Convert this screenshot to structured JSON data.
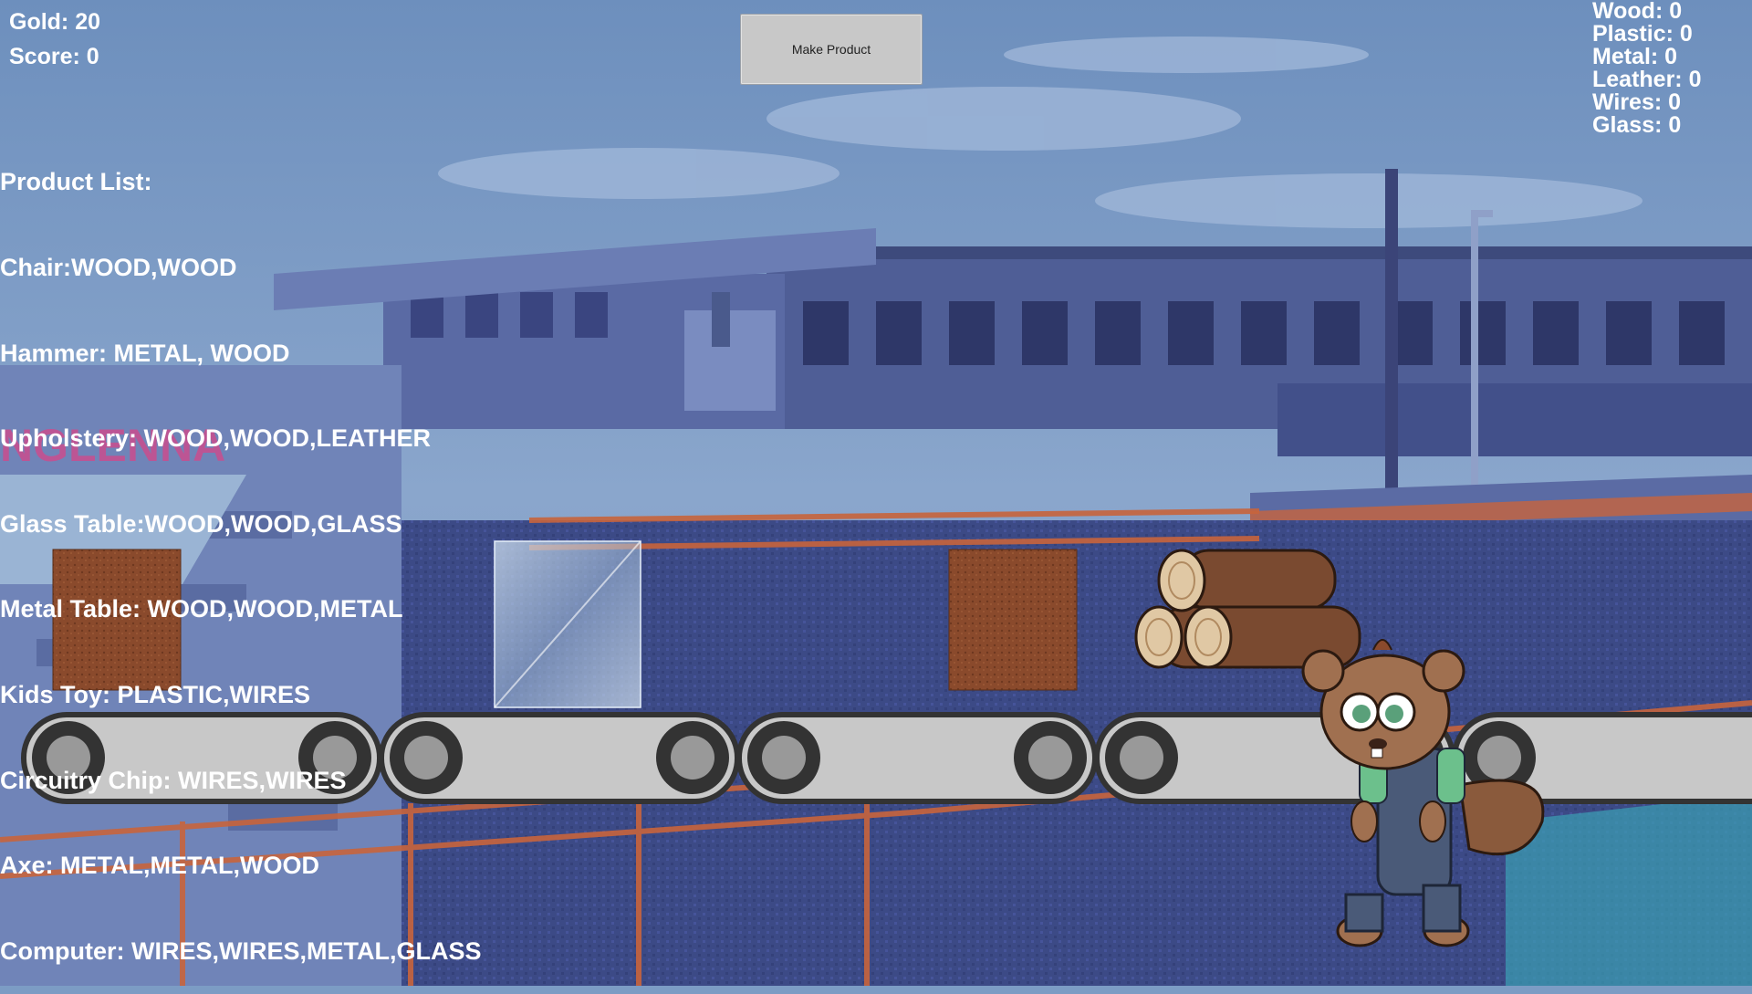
{
  "hud": {
    "gold": "Gold: 20",
    "score": "Score: 0",
    "make_product_label": "Make Product"
  },
  "product_list": {
    "title": "Product List:",
    "items": [
      "Chair:WOOD,WOOD",
      "Hammer: METAL, WOOD",
      "Upholstery: WOOD,WOOD,LEATHER",
      "Glass Table:WOOD,WOOD,GLASS",
      "Metal Table: WOOD,WOOD,METAL",
      "Kids Toy: PLASTIC,WIRES",
      "Circuitry Chip: WIRES,WIRES",
      "Axe: METAL,METAL,WOOD",
      "Computer: WIRES,WIRES,METAL,GLASS"
    ]
  },
  "resources": [
    "Wood: 0",
    "Plastic: 0",
    "Metal: 0",
    "Leather: 0",
    "Wires: 0",
    "Glass: 0"
  ],
  "scene": {
    "wall_graffiti": "NGLENNA",
    "conveyor_items": [
      "leather-block",
      "glass-block",
      "leather-block",
      "wood-logs"
    ],
    "character": "beaver-worker",
    "colors": {
      "sky": "#7c9cc4",
      "building": "#4a5a8c",
      "leather": "#8a4a2c",
      "belt": "#c8c8c8",
      "railing": "#c8643c"
    }
  }
}
